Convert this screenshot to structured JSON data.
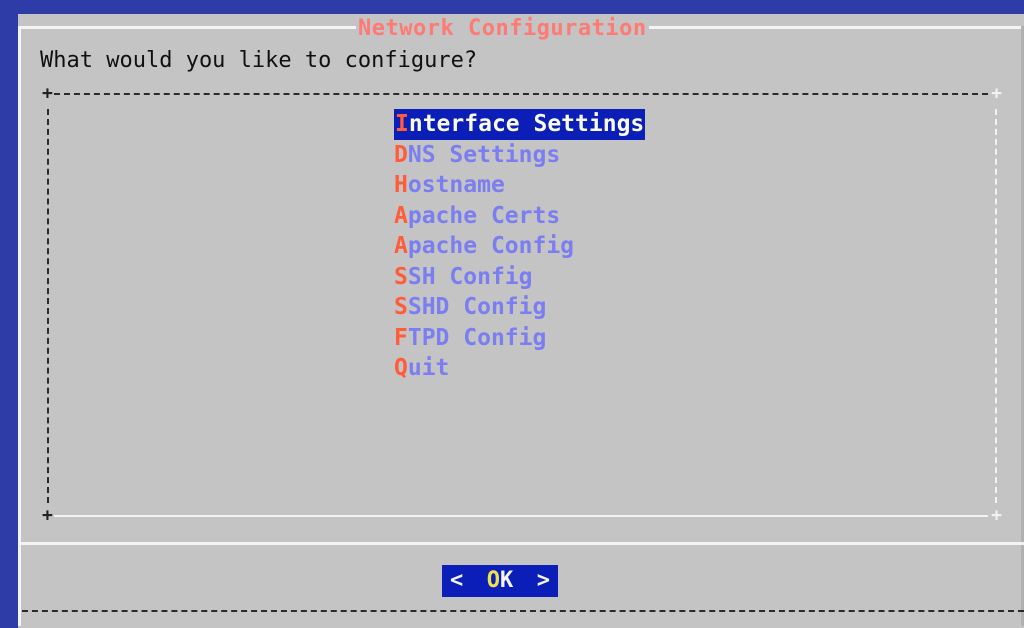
{
  "dialog": {
    "title": "Network Configuration",
    "prompt": "What would you like to configure?"
  },
  "menu": {
    "items": [
      {
        "hot": "I",
        "rest": "nterface Settings",
        "selected": true
      },
      {
        "hot": "D",
        "rest": "NS Settings"
      },
      {
        "hot": "H",
        "rest": "ostname"
      },
      {
        "hot": "A",
        "rest": "pache Certs"
      },
      {
        "hot": "A",
        "rest": "pache Config"
      },
      {
        "hot": "S",
        "rest": "SH Config"
      },
      {
        "hot": "S",
        "rest": "SHD Config"
      },
      {
        "hot": "F",
        "rest": "TPD Config"
      },
      {
        "hot": "Q",
        "rest": "uit"
      }
    ]
  },
  "buttons": {
    "ok": {
      "left": "<",
      "hot": "O",
      "rest": "K",
      "right": ">"
    }
  },
  "colors": {
    "screen_bg": "#2e3ca8",
    "dialog_bg": "#c4c4c4",
    "title": "#ff7a74",
    "hotkey": "#ff5c3a",
    "item": "#7b7ef0",
    "selected_bg": "#0b1fb8",
    "selected_fg": "#fafae8"
  }
}
